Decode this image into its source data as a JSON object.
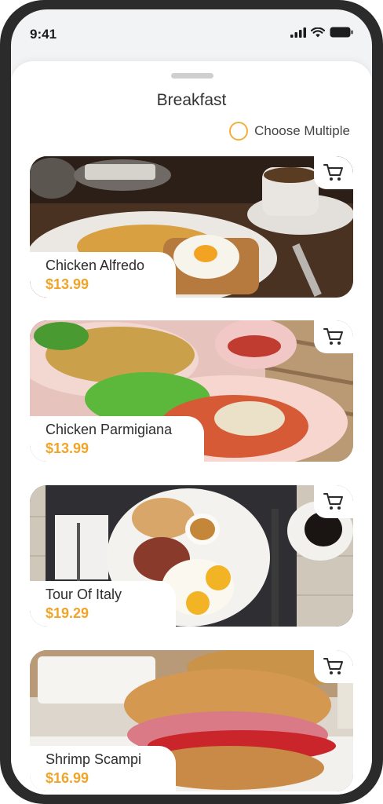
{
  "status_bar": {
    "time": "9:41",
    "icons": [
      "signal-icon",
      "wifi-icon",
      "battery-icon"
    ]
  },
  "sheet": {
    "title": "Breakfast",
    "choose_multiple_label": "Choose Multiple"
  },
  "colors": {
    "accent": "#f0a52a",
    "radio_border": "#f2b03a",
    "text": "#2d2d2d"
  },
  "items": [
    {
      "name": "Chicken Alfredo",
      "price": "$13.99",
      "icon": "cart-icon"
    },
    {
      "name": "Chicken Parmigiana",
      "price": "$13.99",
      "icon": "cart-icon"
    },
    {
      "name": "Tour Of Italy",
      "price": "$19.29",
      "icon": "cart-icon"
    },
    {
      "name": "Shrimp Scampi",
      "price": "$16.99",
      "icon": "cart-icon"
    }
  ]
}
